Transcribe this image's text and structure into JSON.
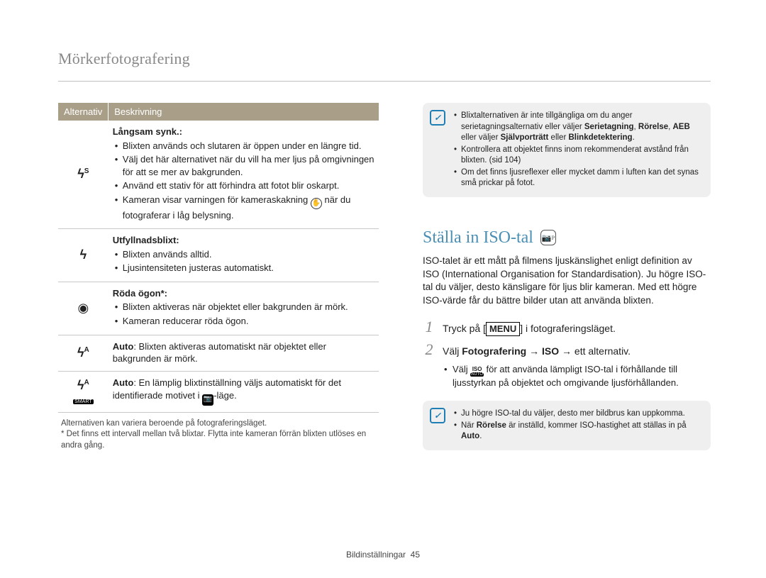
{
  "page_title": "Mörkerfotografering",
  "table": {
    "head_alt": "Alternativ",
    "head_desc": "Beskrivning",
    "rows": [
      {
        "icon": "flash-slow-sync",
        "name": "Långsam synk.",
        "bullets": [
          "Blixten används och slutaren är öppen under en längre tid.",
          "Välj det här alternativet när du vill ha mer ljus på omgivningen för att se mer av bakgrunden.",
          "Använd ett stativ för att förhindra att fotot blir oskarpt.",
          "Kameran visar varningen för kameraskakning ⦿ när du fotograferar i låg belysning."
        ]
      },
      {
        "icon": "flash-fill",
        "name": "Utfyllnadsblixt",
        "bullets": [
          "Blixten används alltid.",
          "Ljusintensiteten justeras automatiskt."
        ]
      },
      {
        "icon": "red-eye",
        "name": "Röda ögon*",
        "bullets": [
          "Blixten aktiveras när objektet eller bakgrunden är mörk.",
          "Kameran reducerar röda ögon."
        ]
      },
      {
        "icon": "flash-auto",
        "plain": "Auto: Blixten aktiveras automatiskt när objektet eller bakgrunden är mörk.",
        "plain_bold": "Auto"
      },
      {
        "icon": "flash-smart-auto",
        "plain": "Auto: En lämplig blixtinställning väljs automatiskt för det identifierade motivet i ⌂-läge.",
        "plain_bold": "Auto"
      }
    ]
  },
  "footnote1": "Alternativen kan variera beroende på fotograferingsläget.",
  "footnote2": "* Det finns ett intervall mellan två blixtar. Flytta inte kameran förrän blixten utlöses en andra gång.",
  "note1": {
    "bullets_html": [
      "Blixtalternativen är inte tillgängliga om du anger serietagningsalternativ eller väljer <b>Serietagning</b>, <b>Rörelse</b>, <b>AEB</b> eller väljer <b>Självporträtt</b> eller <b>Blinkdetektering</b>.",
      "Kontrollera att objektet finns inom rekommenderat avstånd från blixten. (sid 104)",
      "Om det finns ljusreflexer eller mycket damm i luften kan det synas små prickar på fotot."
    ]
  },
  "iso_heading": "Ställa in ISO-tal",
  "iso_para": "ISO-talet är ett mått på filmens ljuskänslighet enligt definition av ISO (International Organisation for Standardisation). Ju högre ISO-tal du väljer, desto känsligare för ljus blir kameran. Med ett högre ISO-värde får du bättre bilder utan att använda blixten.",
  "step1_pre": "Tryck på [",
  "step1_menu": "MENU",
  "step1_post": "] i fotograferingsläget.",
  "step2_html": "Välj <b>Fotografering</b> → <b>ISO</b> → ett alternativ.",
  "step2_sub": "Välj  för att använda lämpligt ISO-tal i förhållande till ljusstyrkan på objektet och omgivande ljusförhållanden.",
  "step2_sub_pre": "Välj ",
  "step2_sub_post": " för att använda lämpligt ISO-tal i förhållande till ljusstyrkan på objektet och omgivande ljusförhållanden.",
  "note2": {
    "bullets_html": [
      "Ju högre ISO-tal du väljer, desto mer bildbrus kan uppkomma.",
      "När <b>Rörelse</b> är inställd, kommer ISO-hastighet att ställas in på <b>Auto</b>."
    ]
  },
  "footer_label": "Bildinställningar",
  "footer_page": "45"
}
